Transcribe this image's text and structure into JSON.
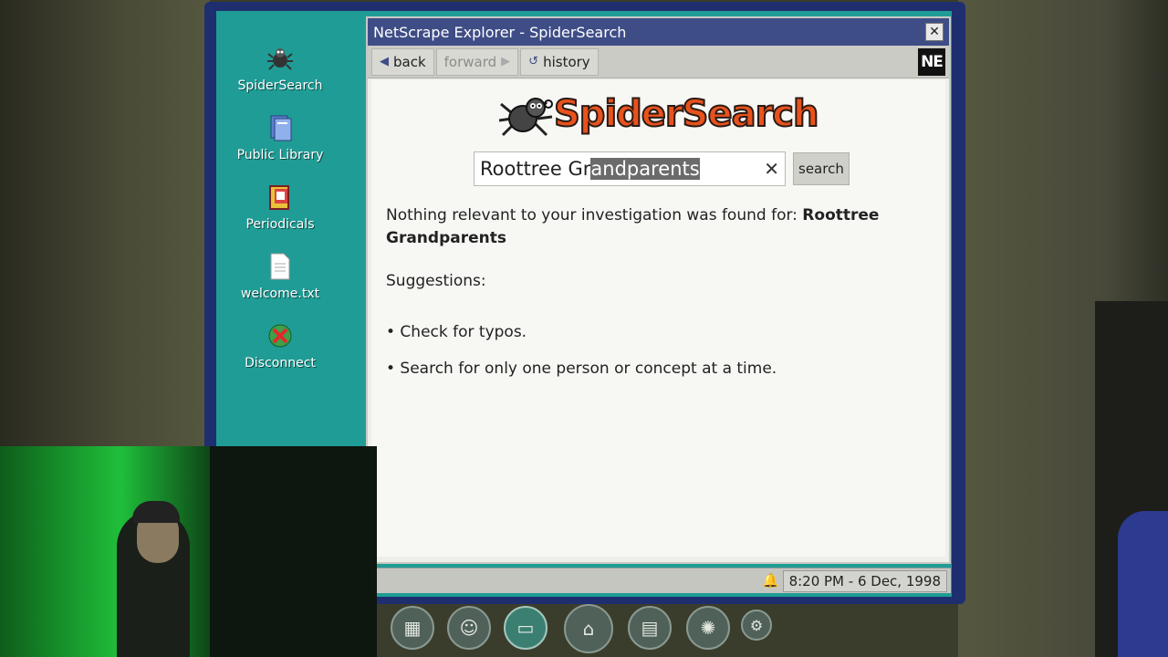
{
  "desktop": {
    "icons": [
      {
        "label": "SpiderSearch",
        "icon": "spider-icon"
      },
      {
        "label": "Public Library",
        "icon": "books-icon"
      },
      {
        "label": "Periodicals",
        "icon": "magazine-icon"
      },
      {
        "label": "welcome.txt",
        "icon": "text-file-icon"
      },
      {
        "label": "Disconnect",
        "icon": "disconnect-icon"
      }
    ]
  },
  "browser": {
    "title": "NetScrape Explorer - SpiderSearch",
    "close_label": "✕",
    "toolbar": {
      "back_label": "back",
      "forward_label": "forward",
      "history_label": "history",
      "logo_text": "NE"
    },
    "page": {
      "logo_text": "SpiderSearch",
      "search_value_plain": "Roottree Gr",
      "search_value_selected": "andparents",
      "clear_label": "✕",
      "search_button_label": "search",
      "result_prefix": "Nothing relevant to your investigation was found for:",
      "result_query": "Roottree Grandparents",
      "suggestions_title": "Suggestions:",
      "suggestions": [
        "• Check for typos.",
        "• Search for only one person or concept at a time."
      ]
    }
  },
  "statusbar": {
    "clock": "8:20 PM - 6 Dec, 1998"
  },
  "dock": {
    "items": [
      "board-icon",
      "profile-search-icon",
      "computer-icon",
      "home-icon",
      "notebook-icon",
      "lightbulb-icon",
      "settings-icon"
    ]
  },
  "colors": {
    "desktop": "#1f9c95",
    "titlebar": "#3f4d86",
    "logo": "#e8521d"
  }
}
